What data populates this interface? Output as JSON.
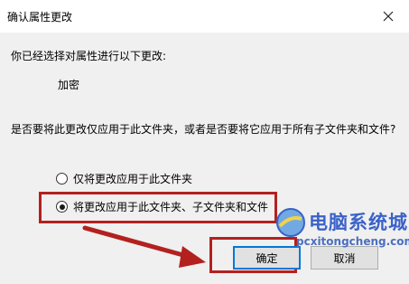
{
  "window": {
    "title": "确认属性更改"
  },
  "content": {
    "lead_text": "你已经选择对属性进行以下更改:",
    "attribute": "加密",
    "question": "是否要将此更改仅应用于此文件夹，或者是否要将它应用于所有子文件夹和文件?"
  },
  "options": [
    {
      "label": "仅将更改应用于此文件夹",
      "checked": false
    },
    {
      "label": "将更改应用于此文件夹、子文件夹和文件",
      "checked": true
    }
  ],
  "buttons": {
    "ok_label": "确定",
    "cancel_label": "取消"
  },
  "annotation": {
    "color": "#b3211e"
  },
  "watermark": {
    "title": "电脑系统城",
    "url": "pcxitongcheng.com"
  }
}
